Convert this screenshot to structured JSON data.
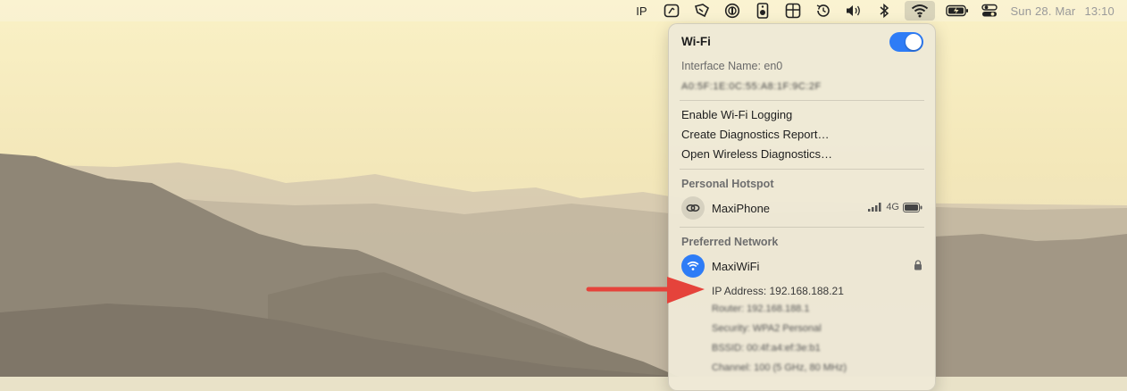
{
  "menubar": {
    "ip_label": "IP",
    "date": "Sun 28. Mar",
    "time": "13:10"
  },
  "wifi_panel": {
    "title": "Wi-Fi",
    "wifi_enabled": true,
    "interface_name": "Interface Name: en0",
    "mac_address_redacted": "A0:5F:1E:0C:55:A8:1F:9C:2F",
    "actions": {
      "enable_logging": "Enable Wi-Fi Logging",
      "create_report": "Create Diagnostics Report…",
      "open_diagnostics": "Open Wireless Diagnostics…"
    },
    "hotspot_section": "Personal Hotspot",
    "hotspot": {
      "name": "MaxiPhone",
      "network_type": "4G"
    },
    "preferred_section": "Preferred Network",
    "preferred": {
      "name": "MaxiWiFi",
      "ip_address": "IP Address: 192.168.188.21",
      "redacted_lines": [
        "Router: 192.168.188.1",
        "Security: WPA2 Personal",
        "BSSID: 00:4f:a4:ef:3e:b1",
        "Channel: 100 (5 GHz, 80 MHz)"
      ]
    }
  },
  "colors": {
    "accent": "#2e7cf6",
    "arrow": "#e5433b"
  }
}
